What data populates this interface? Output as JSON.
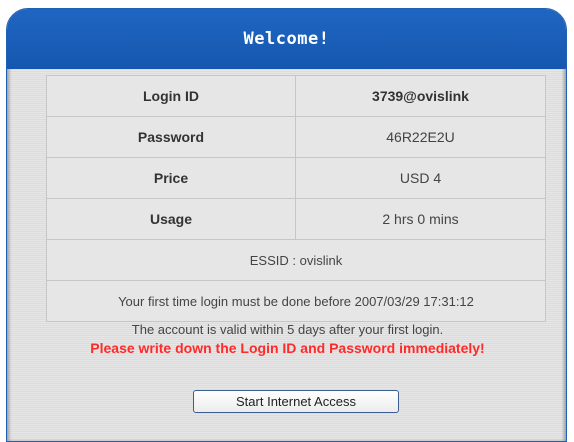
{
  "header": {
    "title": "Welcome!"
  },
  "account": {
    "login_id_label": "Login ID",
    "login_id_value": "3739@ovislink",
    "password_label": "Password",
    "password_value": "46R22E2U",
    "price_label": "Price",
    "price_value": "USD 4",
    "usage_label": "Usage",
    "usage_value": "2 hrs 0 mins",
    "essid_text": "ESSID : ovislink",
    "deadline_text": "Your first time login must be done before 2007/03/29 17:31:12"
  },
  "notice": {
    "validity_text": "The account is valid within 5 days after your first login.",
    "warning_text": "Please write down the Login ID and Password immediately!"
  },
  "actions": {
    "start_button_label": "Start Internet Access"
  },
  "colors": {
    "header_blue": "#1f66c2",
    "warning_red": "#ff2a2a",
    "panel_gray": "#e2e2e2"
  }
}
